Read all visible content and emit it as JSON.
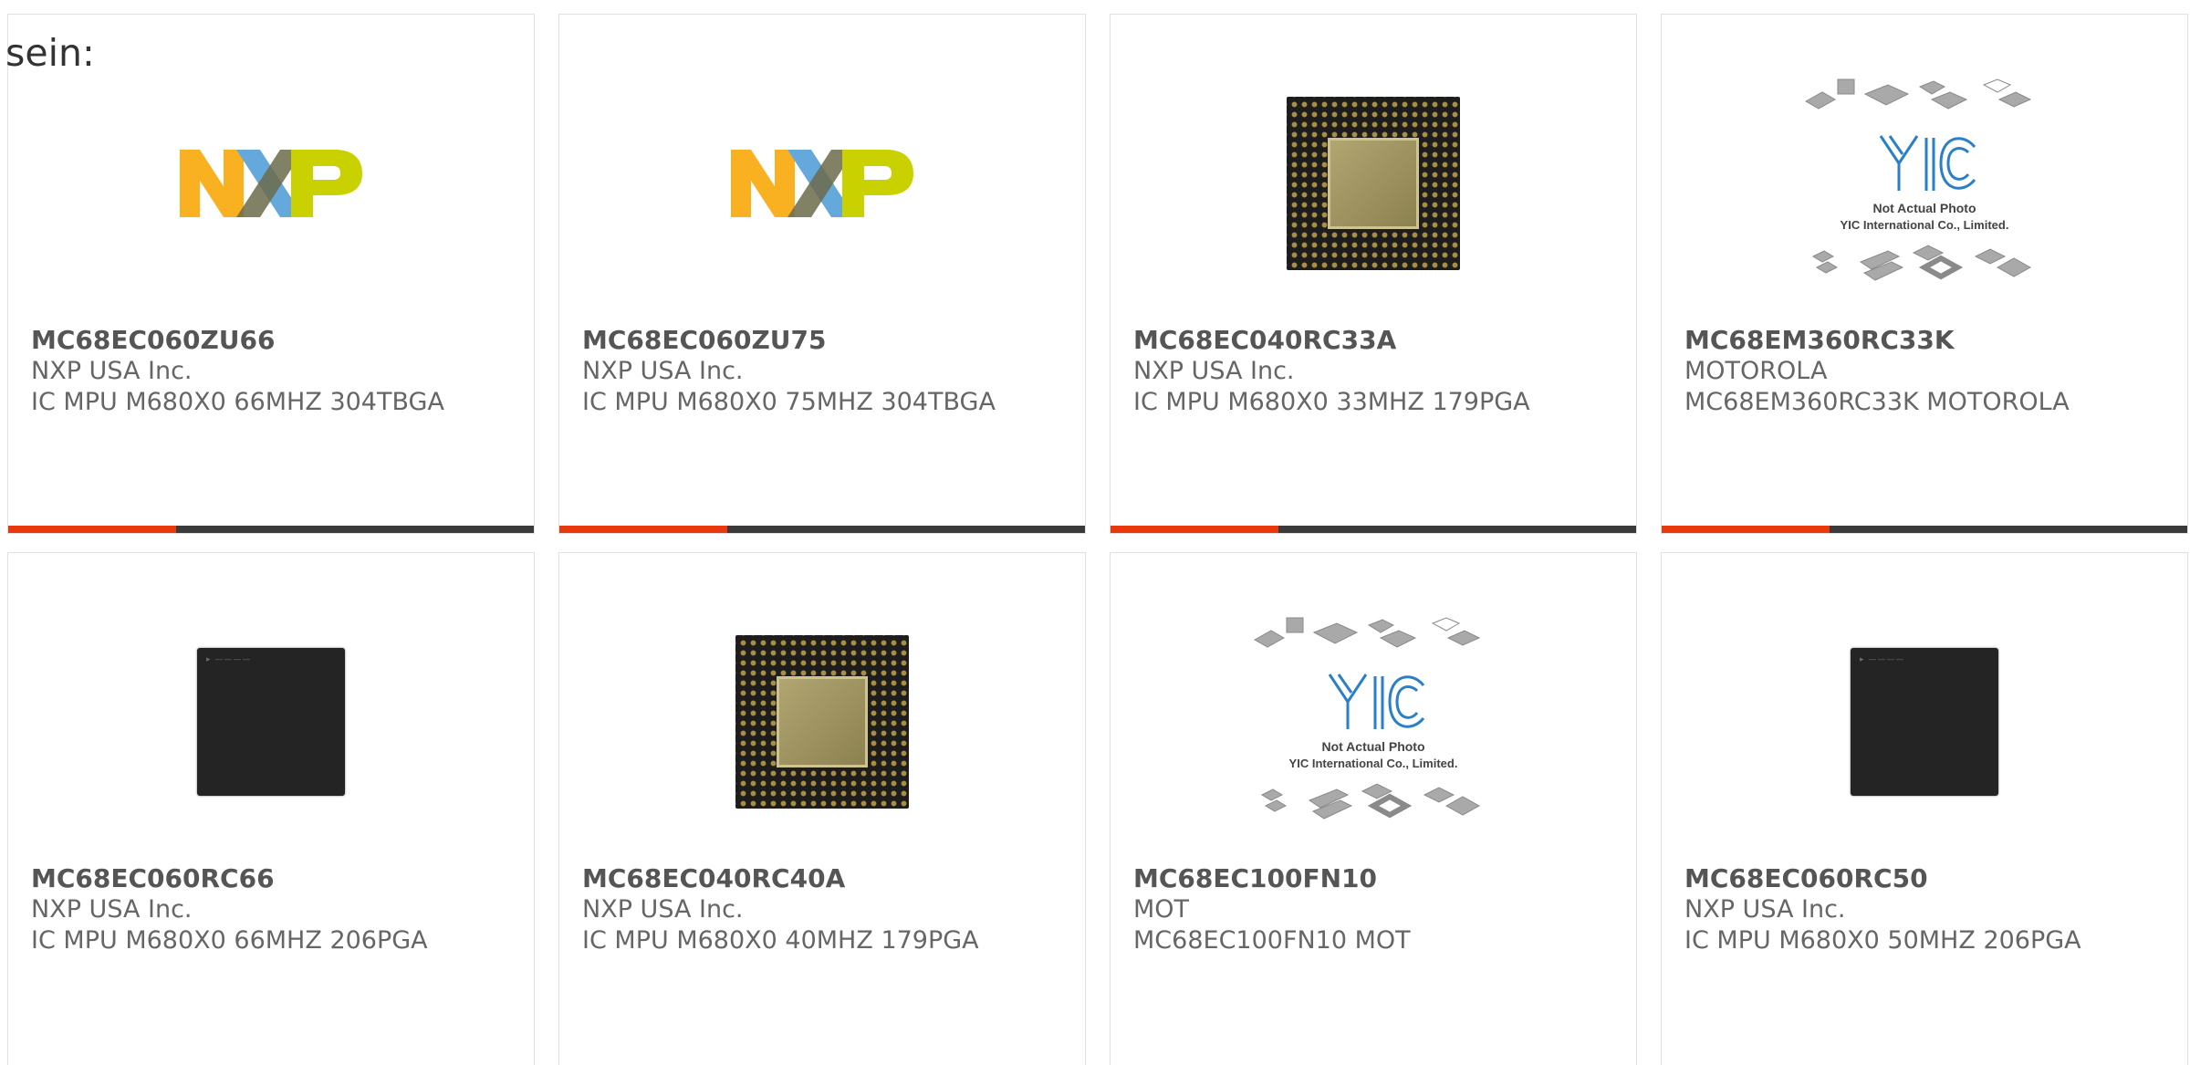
{
  "prefix_text": "sein:",
  "products": [
    {
      "part_number": "MC68EC060ZU66",
      "manufacturer": "NXP USA Inc.",
      "description": "IC MPU M680X0 66MHZ 304TBGA",
      "image": "nxp-logo"
    },
    {
      "part_number": "MC68EC060ZU75",
      "manufacturer": "NXP USA Inc.",
      "description": "IC MPU M680X0 75MHZ 304TBGA",
      "image": "nxp-logo"
    },
    {
      "part_number": "MC68EC040RC33A",
      "manufacturer": "NXP USA Inc.",
      "description": "IC MPU M680X0 33MHZ 179PGA",
      "image": "pga-chip"
    },
    {
      "part_number": "MC68EM360RC33K",
      "manufacturer": "MOTOROLA",
      "description": "MC68EM360RC33K MOTOROLA",
      "image": "yic-placeholder",
      "image_text": [
        "Not Actual Photo",
        "YIC International Co., Limited."
      ]
    },
    {
      "part_number": "MC68EC060RC66",
      "manufacturer": "NXP USA Inc.",
      "description": "IC MPU M680X0 66MHZ 206PGA",
      "image": "dark-chip"
    },
    {
      "part_number": "MC68EC040RC40A",
      "manufacturer": "NXP USA Inc.",
      "description": "IC MPU M680X0 40MHZ 179PGA",
      "image": "pga-chip"
    },
    {
      "part_number": "MC68EC100FN10",
      "manufacturer": "MOT",
      "description": "MC68EC100FN10 MOT",
      "image": "yic-placeholder",
      "image_text": [
        "Not Actual Photo",
        "YIC International Co., Limited."
      ]
    },
    {
      "part_number": "MC68EC060RC50",
      "manufacturer": "NXP USA Inc.",
      "description": "IC MPU M680X0 50MHZ 206PGA",
      "image": "dark-chip"
    }
  ],
  "colors": {
    "accent": "#e8380d",
    "bar": "#3a3a3a",
    "border": "#e1e1e1",
    "nxp_orange": "#f9b122",
    "nxp_blue": "#64a8dc",
    "nxp_green": "#c9d200"
  },
  "image_label": {
    "not_actual_photo": "Not Actual Photo",
    "company": "YIC International Co., Limited."
  }
}
